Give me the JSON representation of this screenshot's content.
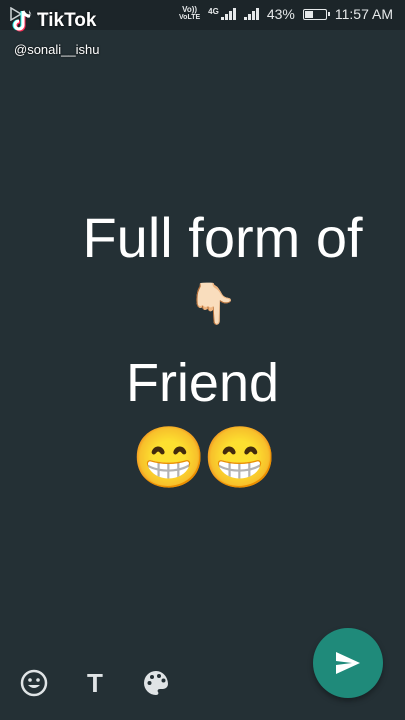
{
  "status_bar": {
    "volte": "VoLTE",
    "network": "4G",
    "battery": "43%",
    "battery_level": 0.43,
    "time": "11:57 AM"
  },
  "watermark": {
    "brand": "TikTok",
    "handle": "@sonali__ishu"
  },
  "content": {
    "line1": "Full form of",
    "pointer": "👇🏻",
    "line2": "Friend",
    "emojis": "😁😁"
  },
  "toolbar": {
    "emoji_icon": "smiley-icon",
    "text_icon": "text-format-icon",
    "palette_icon": "palette-icon",
    "send_icon": "send-icon",
    "text_glyph": "T"
  },
  "colors": {
    "background": "#243035",
    "send_button": "#1f8a7a"
  }
}
